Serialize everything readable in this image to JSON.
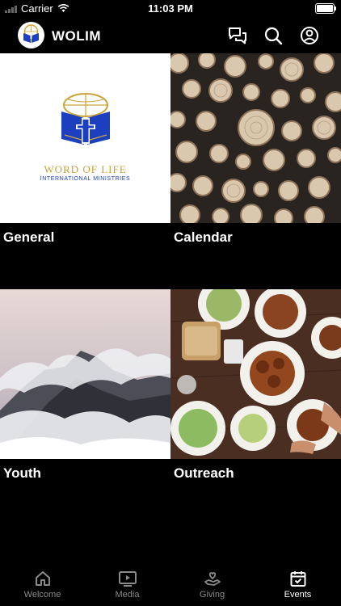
{
  "status_bar": {
    "carrier": "Carrier",
    "time": "11:03 PM"
  },
  "header": {
    "title": "WOLIM",
    "icons": [
      "chat-icon",
      "search-icon",
      "account-icon"
    ]
  },
  "tiles": [
    {
      "label": "General",
      "image": "word-of-life-logo"
    },
    {
      "label": "Calendar",
      "image": "wood-logs-photo"
    },
    {
      "label": "Youth",
      "image": "misty-mountain-photo"
    },
    {
      "label": "Outreach",
      "image": "food-table-photo"
    }
  ],
  "logo_text": {
    "line1": "WORD OF LIFE",
    "line2": "INTERNATIONAL MINISTRIES"
  },
  "tabbar": {
    "items": [
      {
        "label": "Welcome",
        "icon": "home-icon",
        "active": false
      },
      {
        "label": "Media",
        "icon": "play-icon",
        "active": false
      },
      {
        "label": "Giving",
        "icon": "heart-hand-icon",
        "active": false
      },
      {
        "label": "Events",
        "icon": "calendar-check-icon",
        "active": true
      }
    ]
  },
  "colors": {
    "accent_blue": "#1b3fbf",
    "gold": "#c9a43a",
    "inactive_tab": "#8a8a8a"
  }
}
